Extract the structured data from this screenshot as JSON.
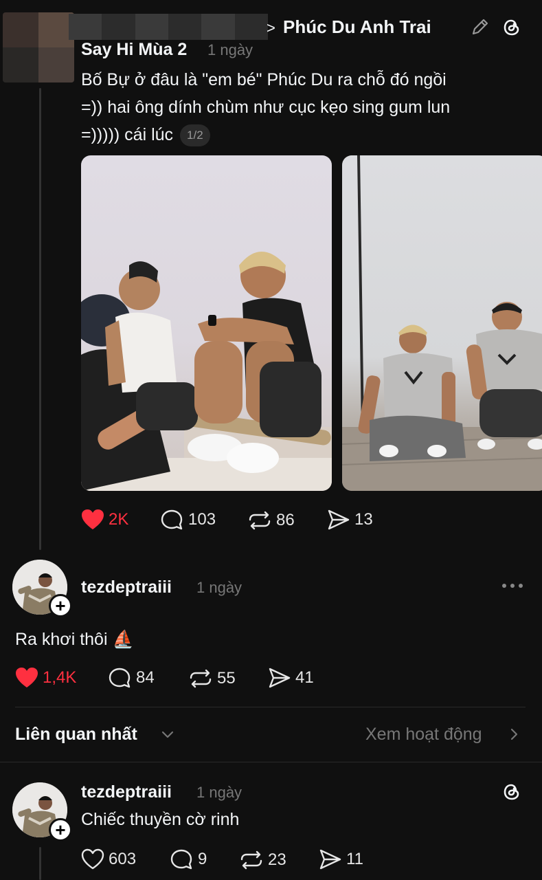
{
  "header": {
    "crumb_separator": ">",
    "title": "Phúc Du Anh Trai"
  },
  "post": {
    "author": "Say Hi Mùa 2",
    "time": "1 ngày",
    "text": "Bố Bự ở đâu là \"em bé\" Phúc Du ra chỗ đó ngồi =)) hai ông dính chùm như cục kẹo sing gum lun =))))) cái lúc",
    "line1": "Bố Bự ở đâu là \"em bé\" Phúc Du ra chỗ đó ngồi",
    "line2": "=)) hai ông dính chùm như cục kẹo sing gum lun",
    "line3": "=))))) cái lúc",
    "page_indicator": "1/2",
    "likes": "2K",
    "replies": "103",
    "reposts": "86",
    "shares": "13"
  },
  "reply1": {
    "username": "tezdeptraiii",
    "time": "1 ngày",
    "text": "Ra khơi thôi ⛵",
    "likes": "1,4K",
    "replies": "84",
    "reposts": "55",
    "shares": "41"
  },
  "sort": {
    "label": "Liên quan nhất",
    "activity_link": "Xem hoạt động"
  },
  "reply2": {
    "username": "tezdeptraiii",
    "time": "1 ngày",
    "text": "Chiếc thuyền cờ rinh",
    "likes": "603",
    "replies": "9",
    "reposts": "23",
    "shares": "11"
  },
  "colors": {
    "background": "#101010",
    "like_red": "#ff3040",
    "muted": "#777777"
  }
}
